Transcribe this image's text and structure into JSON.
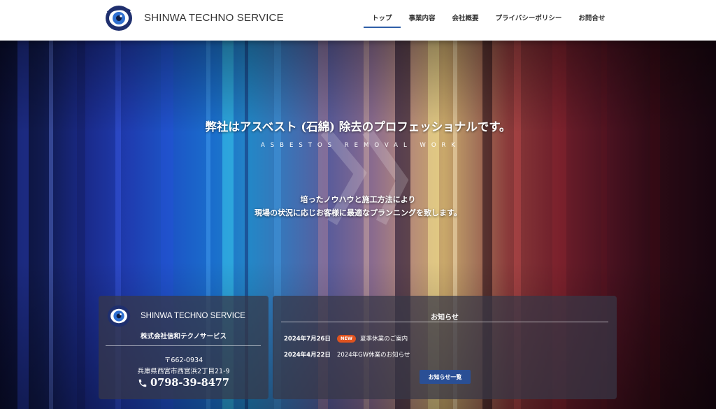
{
  "header": {
    "brand": "SHINWA TECHNO SERVICE",
    "logo_icon": "eye-logo-icon",
    "nav": [
      {
        "label": "トップ",
        "active": true
      },
      {
        "label": "事業内容",
        "active": false
      },
      {
        "label": "会社概要",
        "active": false
      },
      {
        "label": "プライバシーポリシー",
        "active": false
      },
      {
        "label": "お問合せ",
        "active": false
      }
    ]
  },
  "hero": {
    "title": "弊社はアスベスト (石綿) 除去のプロフェッショナルです。",
    "subtitle": "ASBESTOS REMOVAL WORK",
    "line1": "培ったノウハウと施工方法により",
    "line2": "現場の状況に応じお客様に最適なプランニングを致します。"
  },
  "company": {
    "brand": "SHINWA TECHNO SERVICE",
    "name": "株式会社信和テクノサービス",
    "zip": "〒662-0934",
    "address": "兵庫県西宮市西宮浜2丁目21-9",
    "phone": "0798-39-8477",
    "phone_icon": "phone-icon"
  },
  "news": {
    "title": "お知らせ",
    "items": [
      {
        "date": "2024年7月26日",
        "badge": "NEW",
        "text": "夏季休業のご案内"
      },
      {
        "date": "2024年4月22日",
        "badge": "",
        "text": "2024年GW休業のお知らせ"
      }
    ],
    "button_label": "お知らせ一覧"
  },
  "colors": {
    "accent": "#2a4f95",
    "badge": "#e0531f",
    "header_bg": "#ffffff"
  }
}
